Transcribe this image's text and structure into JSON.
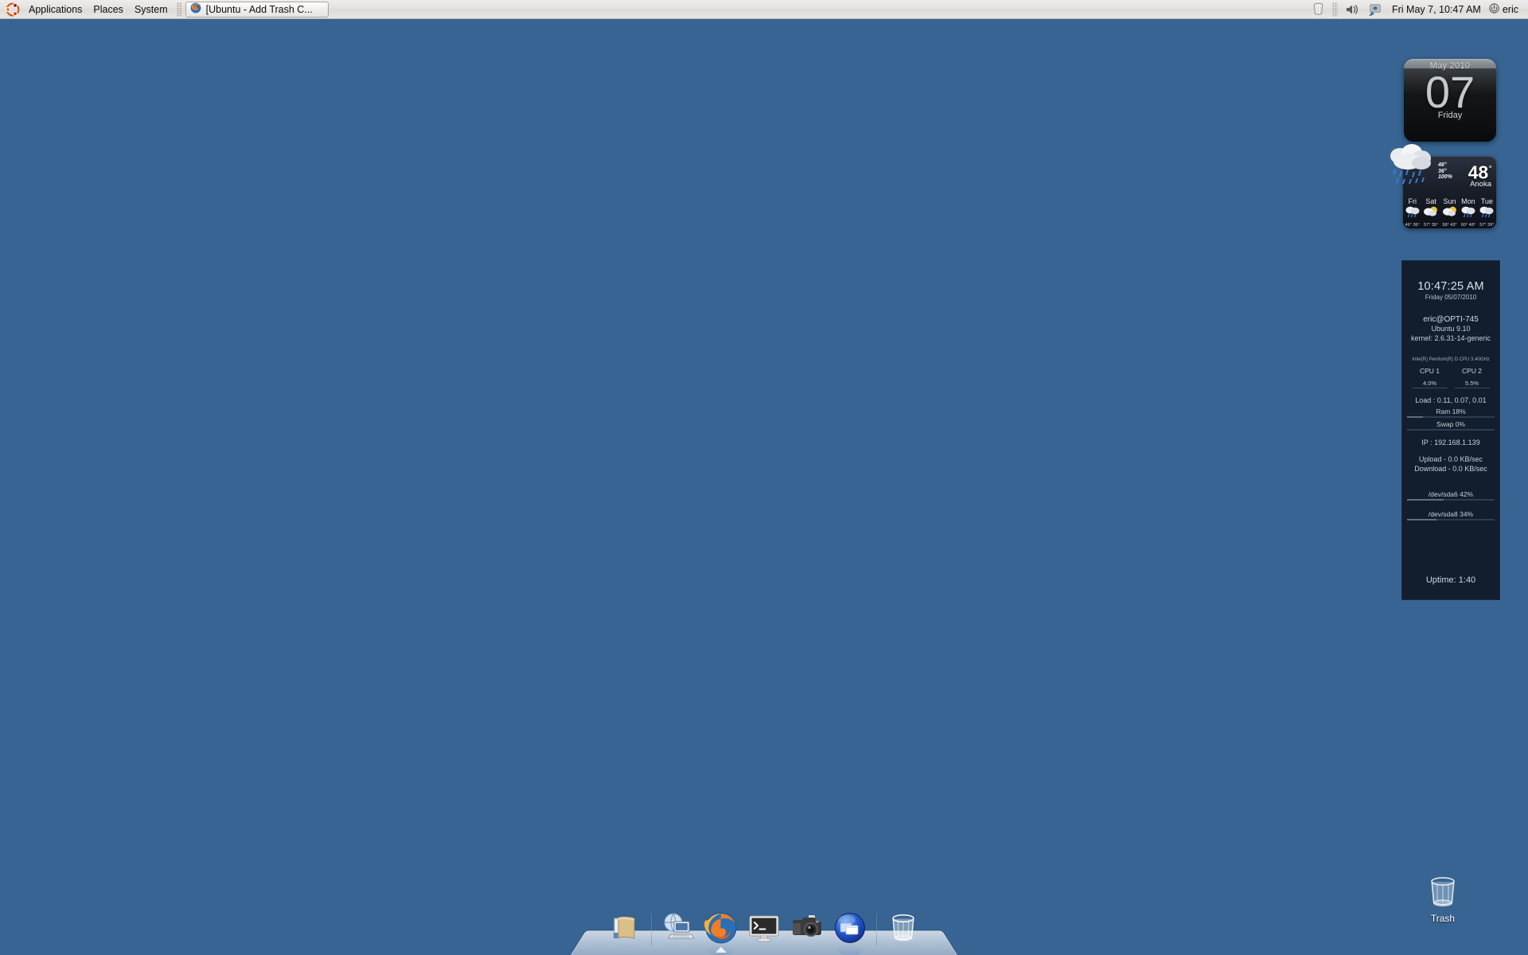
{
  "desktop": {
    "background_color": "#376492"
  },
  "top_panel": {
    "logo_name": "ubuntu-logo",
    "menus": [
      {
        "label": "Applications",
        "name": "menu-applications"
      },
      {
        "label": "Places",
        "name": "menu-places"
      },
      {
        "label": "System",
        "name": "menu-system"
      }
    ],
    "task_button": {
      "label": "[Ubuntu - Add Trash C...",
      "icon": "firefox-icon"
    },
    "tray": [
      {
        "name": "trash-applet-icon",
        "label": "Trash"
      },
      {
        "name": "volume-icon",
        "label": "Volume"
      },
      {
        "name": "network-monitor-icon",
        "label": "Network"
      }
    ],
    "clock": "Fri May  7, 10:47 AM",
    "user": {
      "name": "eric",
      "power_icon": "power-icon"
    }
  },
  "calendar_widget": {
    "month": "May 2010",
    "day": "07",
    "weekday": "Friday"
  },
  "weather_widget": {
    "condition_icon": "rain-cloud-icon",
    "high": "46°",
    "low": "36°",
    "precip": "100%",
    "current_temp": "48",
    "degree_symbol": "°",
    "city": "Anoka",
    "forecast": [
      {
        "day": "Fri",
        "icon": "rain-icon",
        "temps": "46° 36°"
      },
      {
        "day": "Sat",
        "icon": "partly-sunny-icon",
        "temps": "57° 35°"
      },
      {
        "day": "Sun",
        "icon": "partly-sunny-icon",
        "temps": "58° 43°"
      },
      {
        "day": "Mon",
        "icon": "rain-icon",
        "temps": "60° 48°"
      },
      {
        "day": "Tue",
        "icon": "rain-icon",
        "temps": "57° 39°"
      }
    ]
  },
  "conky": {
    "time": "10:47:25 AM",
    "date": "Friday 05/07/2010",
    "host": "eric@OPTI-745",
    "distro": "Ubuntu 9.10",
    "kernel": "kernel: 2.6.31-14-generic",
    "cpu_model": "Intel(R) Pentium(R) D CPU 3.40GHz",
    "cpus": [
      {
        "label": "CPU 1",
        "pct": "4.0%",
        "value": 4
      },
      {
        "label": "CPU 2",
        "pct": "5.5%",
        "value": 5.5
      }
    ],
    "load": "Load : 0.11, 0.07, 0.01",
    "ram": {
      "label": "Ram 18%",
      "value": 18
    },
    "swap": {
      "label": "Swap 0%",
      "value": 0
    },
    "ip": "IP : 192.168.1.139",
    "upload": "Upload - 0.0 KB/sec",
    "download": "Download - 0.0 KB/sec",
    "disks": [
      {
        "label": "/dev/sda6 42%",
        "value": 42
      },
      {
        "label": "/dev/sda8 34%",
        "value": 34
      }
    ],
    "uptime": "Uptime: 1:40"
  },
  "desktop_icons": [
    {
      "label": "Trash",
      "icon": "trash-icon"
    }
  ],
  "dock": {
    "items": [
      {
        "name": "dock-item-files",
        "icon": "folder-icon",
        "label": "Files",
        "running": false
      },
      {
        "name": "dock-item-network",
        "icon": "network-computer-icon",
        "label": "Network",
        "running": false
      },
      {
        "name": "dock-item-firefox",
        "icon": "firefox-icon",
        "label": "Firefox",
        "running": true
      },
      {
        "name": "dock-item-terminal",
        "icon": "terminal-icon",
        "label": "Terminal",
        "running": false
      },
      {
        "name": "dock-item-camera",
        "icon": "camera-icon",
        "label": "Camera",
        "running": false
      },
      {
        "name": "dock-item-windows",
        "icon": "window-switcher-icon",
        "label": "Window Switcher",
        "running": false
      },
      {
        "name": "dock-item-trash",
        "icon": "trash-icon",
        "label": "Trash",
        "running": false
      }
    ]
  }
}
